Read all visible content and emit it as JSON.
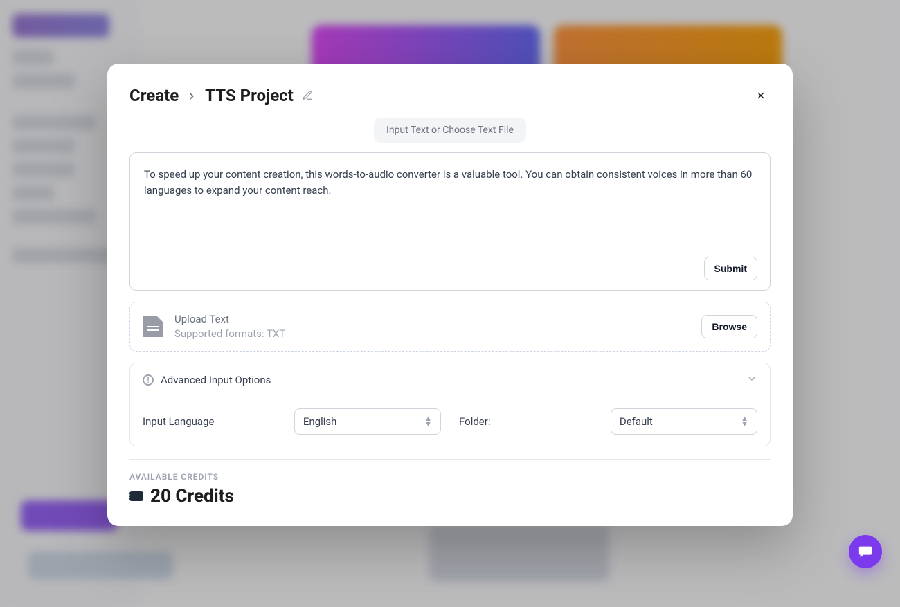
{
  "breadcrumb": {
    "root": "Create",
    "current": "TTS Project"
  },
  "chip_label": "Input Text or Choose Text File",
  "textarea_value": "To speed up your content creation, this words-to-audio converter is a valuable tool. You can obtain consistent voices in more than 60 languages to expand your content reach.",
  "submit_label": "Submit",
  "upload": {
    "title": "Upload Text",
    "subtitle": "Supported formats: TXT",
    "browse_label": "Browse"
  },
  "advanced": {
    "header": "Advanced Input Options",
    "language_label": "Input Language",
    "language_value": "English",
    "folder_label": "Folder:",
    "folder_value": "Default"
  },
  "credits": {
    "label": "AVAILABLE CREDITS",
    "value": "20 Credits"
  }
}
